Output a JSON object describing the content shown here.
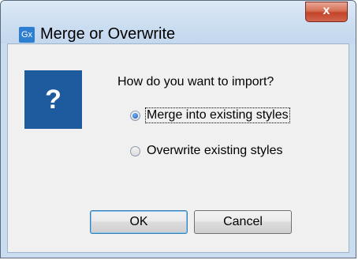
{
  "window": {
    "app_icon_text": "Gx",
    "title": "Merge or Overwrite",
    "close_label": "x"
  },
  "dialog": {
    "icon": "question-icon",
    "icon_glyph": "?",
    "prompt": "How do you want to import?",
    "options": [
      {
        "label": "Merge into existing styles",
        "selected": true
      },
      {
        "label": "Overwrite existing styles",
        "selected": false
      }
    ],
    "ok_label": "OK",
    "cancel_label": "Cancel"
  },
  "colors": {
    "icon_background": "#1d5a9e",
    "client_background": "#f0f0f0",
    "close_button": "#c3442a"
  }
}
